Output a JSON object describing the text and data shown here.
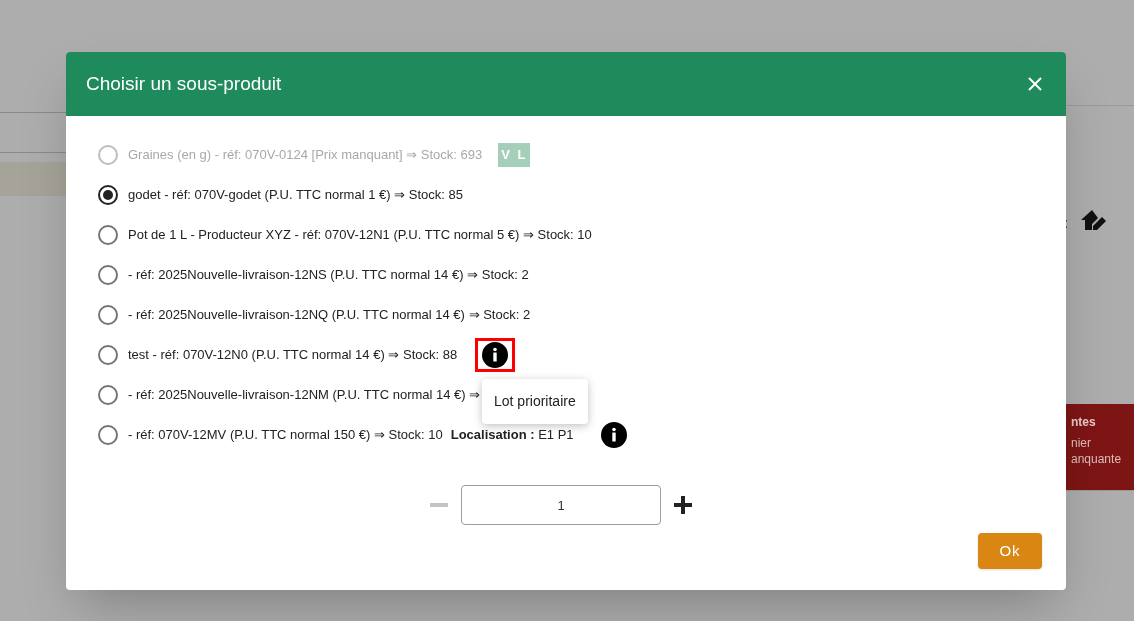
{
  "background": {
    "colon": ":",
    "alert": {
      "title": "ntes",
      "lines": [
        "nier",
        "anquante"
      ]
    }
  },
  "dialog": {
    "title": "Choisir un sous-produit",
    "options": [
      {
        "label": "Graines (en g) - réf: 070V-0124 [Prix manquant] ⇒ Stock: 693",
        "selected": false,
        "disabled": true,
        "badge": "V L",
        "info_icon": false
      },
      {
        "label": "godet - réf: 070V-godet (P.U. TTC normal 1 €) ⇒ Stock: 85",
        "selected": true,
        "disabled": false,
        "info_icon": false
      },
      {
        "label": "Pot de 1 L - Producteur XYZ - réf: 070V-12N1 (P.U. TTC normal 5 €) ⇒ Stock: 10",
        "selected": false,
        "disabled": false,
        "info_icon": false
      },
      {
        "label": "- réf: 2025Nouvelle-livraison-12NS (P.U. TTC normal 14 €) ⇒ Stock: 2",
        "selected": false,
        "disabled": false,
        "info_icon": false
      },
      {
        "label": "- réf: 2025Nouvelle-livraison-12NQ (P.U. TTC normal 14 €) ⇒ Stock: 2",
        "selected": false,
        "disabled": false,
        "info_icon": false
      },
      {
        "label": "test - réf: 070V-12N0 (P.U. TTC normal 14 €) ⇒ Stock: 88",
        "selected": false,
        "disabled": false,
        "info_icon": true,
        "highlighted": true,
        "tooltip": "Lot prioritaire"
      },
      {
        "label": "- réf: 2025Nouvelle-livraison-12NM (P.U. TTC normal 14 €) ⇒",
        "selected": false,
        "disabled": false
      },
      {
        "label": "- réf: 070V-12MV (P.U. TTC normal 150 €) ⇒ Stock: 10",
        "selected": false,
        "disabled": false,
        "location": "**Localisation :** E1 P1",
        "info_icon": true
      }
    ],
    "quantity": {
      "value": "1",
      "minus_disabled": true
    },
    "ok_button": "Ok"
  }
}
